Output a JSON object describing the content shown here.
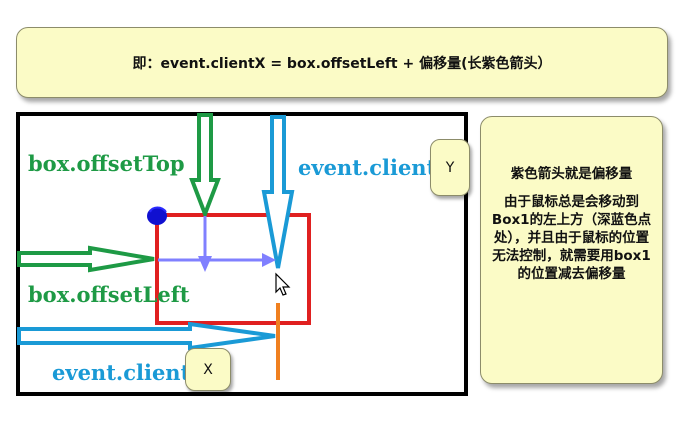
{
  "top_callout": {
    "text": "即：event.clientX = box.offsetLeft + 偏移量(长紫色箭头）"
  },
  "side_callout": {
    "line1": "紫色箭头就是偏移量",
    "line2": "由于鼠标总是会移动到Box1的左上方（深蓝色点处），并且由于鼠标的位置无法控制，就需要用box1的位置减去偏移量"
  },
  "labels": {
    "offset_top": "box.offsetTop",
    "offset_left": "box.offsetLeft",
    "client_y": "event.client",
    "client_x": "event.client",
    "y_suffix": "Y",
    "x_suffix": "X"
  },
  "colors": {
    "green": "#1e9a45",
    "blue": "#1a9ad6",
    "purple": "#8080ff",
    "red": "#e02020",
    "orange": "#f08020",
    "callout_bg": "#fbfbc6"
  }
}
